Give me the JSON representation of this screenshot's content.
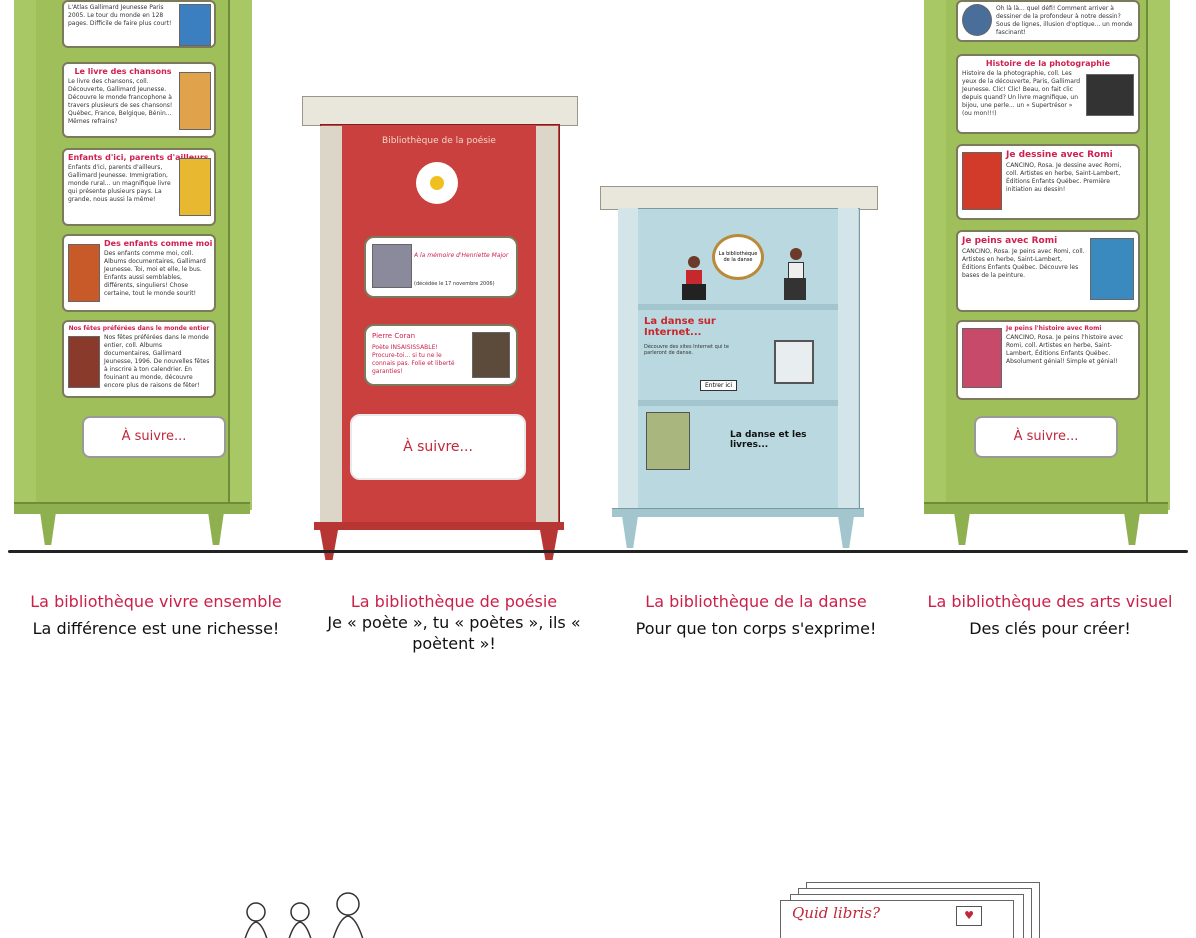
{
  "shelves": [
    {
      "title": "La bibliothèque vivre ensemble",
      "subtitle": "La différence est une richesse!",
      "cards": [
        {
          "title": "",
          "text": "L'Atlas Gallimard Jeunesse Paris 2005. Le tour du monde en 128 pages. Difficile de faire plus court!"
        },
        {
          "title": "Le livre des chansons",
          "text": "Le livre des chansons, coll. Découverte, Gallimard Jeunesse. Découvre le monde francophone à travers plusieurs de ses chansons! Québec, France, Belgique, Bénin... Mêmes refrains?"
        },
        {
          "title": "Enfants d'ici, parents d'ailleurs",
          "text": "Enfants d'ici, parents d'ailleurs, Gallimard Jeunesse. Immigration, monde rural... un magnifique livre qui présente plusieurs pays. La grande, nous aussi la même!"
        },
        {
          "title": "Des enfants comme moi",
          "text": "Des enfants comme moi, coll. Albums documentaires, Gallimard Jeunesse. Toi, moi et elle, le bus. Enfants aussi semblables, différents, singuliers! Chose certaine, tout le monde sourit!"
        },
        {
          "title": "Nos fêtes préférées dans le monde entier",
          "text": "Nos fêtes préférées dans le monde entier, coll. Albums documentaires, Gallimard Jeunesse, 1996. De nouvelles fêtes à inscrire à ton calendrier. En fouinant au monde, découvre encore plus de raisons de fêter!"
        }
      ],
      "next": "À suivre..."
    },
    {
      "title": "La bibliothèque de poésie",
      "subtitle": "Je « poète », tu « poètes », ils « poètent »!",
      "header": "Bibliothèque de la poésie",
      "cards": [
        {
          "title": "À la mémoire d'Henriette Major",
          "text": "(décédée le 17 novembre 2006)"
        },
        {
          "title": "Pierre Coran",
          "text": "Poète INSAISISSABLE! Procure-toi... si tu ne le connais pas. Folie et liberté garanties!"
        }
      ],
      "next": "À suivre..."
    },
    {
      "title": "La bibliothèque de la danse",
      "subtitle": "Pour que ton corps s'exprime!",
      "medallion": "La bibliothèque de la danse",
      "sections": [
        {
          "title": "La danse sur Internet...",
          "text": "Découvre des sites Internet qui te parleront de danse.",
          "button": "Entrer ici"
        },
        {
          "title": "La danse et les livres..."
        }
      ]
    },
    {
      "title": "La bibliothèque des arts visuel",
      "subtitle": "Des clés pour créer!",
      "cards": [
        {
          "title": "",
          "text": "Oh là là... quel défi! Comment arriver à dessiner de la profondeur à notre dessin? Sous de lignes, illusion d'optique... un monde fascinant!"
        },
        {
          "title": "Histoire de la photographie",
          "text": "Histoire de la photographie, coll. Les yeux de la découverte, Paris, Gallimard Jeunesse. Clic! Clic! Beau, on fait clic depuis quand? Un livre magnifique, un bijou, une perle... un « Supertrésor » (ou mon!!!)"
        },
        {
          "title": "Je dessine avec Romi",
          "text": "CANCINO, Rosa. Je dessine avec Romi, coll. Artistes en herbe, Saint-Lambert, Éditions Enfants Québec. Première initiation au dessin!"
        },
        {
          "title": "Je peins avec Romi",
          "text": "CANCINO, Rosa. Je peins avec Romi, coll. Artistes en herbe, Saint-Lambert, Éditions Enfants Québec. Découvre les bases de la peinture."
        },
        {
          "title": "Je peins l'histoire avec Romi",
          "text": "CANCINO, Rosa. Je peins l'histoire avec Romi, coll. Artistes en herbe, Saint-Lambert, Éditions Enfants Québec. Absolument génial! Simple et génial!"
        }
      ],
      "next": "À suivre..."
    }
  ],
  "bottom": {
    "postcard_title": "Quid libris?"
  },
  "colors": {
    "caption_red": "#cc1f49",
    "green_shelf": "#9fbf5a",
    "red_shelf": "#c9403e",
    "blue_shelf": "#b9d8df"
  }
}
